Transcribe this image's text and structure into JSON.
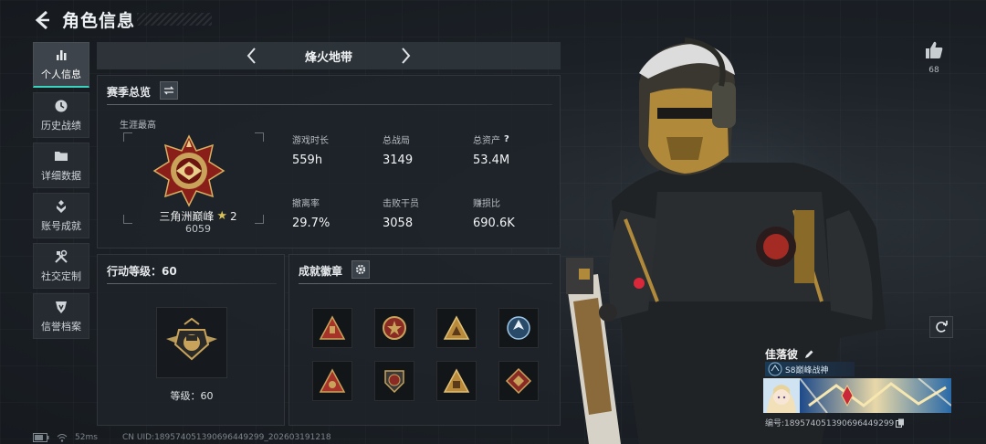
{
  "header": {
    "title": "角色信息"
  },
  "sidebar": {
    "items": [
      {
        "label": "个人信息",
        "icon": "bar-chart-icon",
        "active": true
      },
      {
        "label": "历史战绩",
        "icon": "clock-icon"
      },
      {
        "label": "详细数据",
        "icon": "folder-icon"
      },
      {
        "label": "账号成就",
        "icon": "medal-icon"
      },
      {
        "label": "社交定制",
        "icon": "tools-icon"
      },
      {
        "label": "信誉档案",
        "icon": "shield-icon"
      }
    ]
  },
  "mode": {
    "name": "烽火地带"
  },
  "season": {
    "title": "赛季总览",
    "career_label": "生涯最高",
    "rank_name": "三角洲巅峰",
    "rank_stars": "2",
    "rank_score": "6059",
    "stats": [
      {
        "label": "游戏时长",
        "value": "559h"
      },
      {
        "label": "总战局",
        "value": "3149"
      },
      {
        "label": "总资产",
        "value": "53.4M",
        "help": "?"
      },
      {
        "label": "撤离率",
        "value": "29.7%"
      },
      {
        "label": "击败干员",
        "value": "3058"
      },
      {
        "label": "赚损比",
        "value": "690.6K"
      }
    ]
  },
  "level": {
    "title": "行动等级：60",
    "level_text": "等级：60"
  },
  "badges": {
    "title": "成就徽章"
  },
  "statusbar": {
    "ping": "52ms",
    "uid": "CN UID:18957405139069644929​9_202603191218"
  },
  "like": {
    "count": "68"
  },
  "player": {
    "name": "佳落彼",
    "title": "S8巅峰战神",
    "id": "编号:18957405139069644929​9"
  },
  "colors": {
    "accent": "#39d3c0",
    "gold": "#c9a35a",
    "panel": "#1e2329"
  }
}
